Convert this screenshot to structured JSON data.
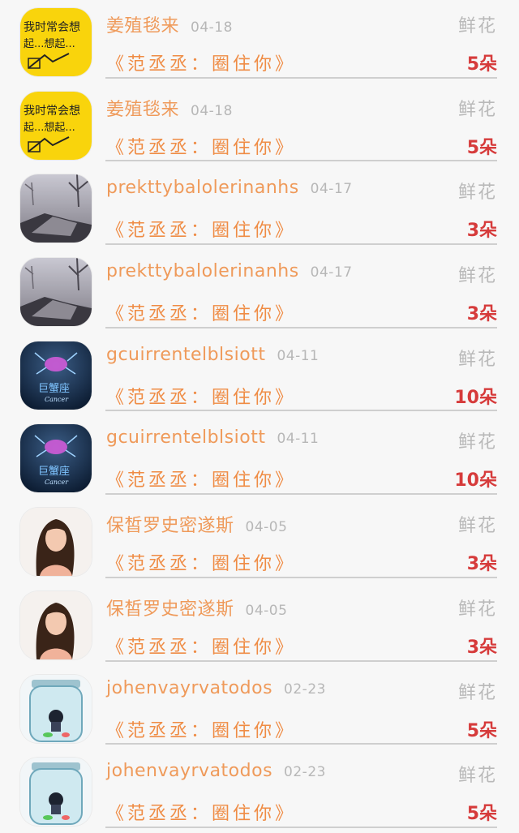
{
  "records": [
    {
      "name": "姜殖毯来",
      "date": "04-18",
      "gift": "鲜花",
      "title": "《范丞丞：圈住你》",
      "count": "5朵",
      "avatar_icon": "handwriting-avatar-icon"
    },
    {
      "name": "姜殖毯来",
      "date": "04-18",
      "gift": "鲜花",
      "title": "《范丞丞：圈住你》",
      "count": "5朵",
      "avatar_icon": "handwriting-avatar-icon"
    },
    {
      "name": "prekttybalolerinanhs",
      "date": "04-17",
      "gift": "鲜花",
      "title": "《范丞丞：圈住你》",
      "count": "3朵",
      "avatar_icon": "misty-forest-avatar-icon"
    },
    {
      "name": "prekttybalolerinanhs",
      "date": "04-17",
      "gift": "鲜花",
      "title": "《范丞丞：圈住你》",
      "count": "3朵",
      "avatar_icon": "misty-forest-avatar-icon"
    },
    {
      "name": "gcuirrentelblsiott",
      "date": "04-11",
      "gift": "鲜花",
      "title": "《范丞丞：圈住你》",
      "count": "10朵",
      "avatar_icon": "cancer-zodiac-avatar-icon"
    },
    {
      "name": "gcuirrentelblsiott",
      "date": "04-11",
      "gift": "鲜花",
      "title": "《范丞丞：圈住你》",
      "count": "10朵",
      "avatar_icon": "cancer-zodiac-avatar-icon"
    },
    {
      "name": "保皙罗史密遂斯",
      "date": "04-05",
      "gift": "鲜花",
      "title": "《范丞丞：圈住你》",
      "count": "3朵",
      "avatar_icon": "woman-portrait-avatar-icon"
    },
    {
      "name": "保皙罗史密遂斯",
      "date": "04-05",
      "gift": "鲜花",
      "title": "《范丞丞：圈住你》",
      "count": "3朵",
      "avatar_icon": "woman-portrait-avatar-icon"
    },
    {
      "name": "johenvayrvatodos",
      "date": "02-23",
      "gift": "鲜花",
      "title": "《范丞丞：圈住你》",
      "count": "5朵",
      "avatar_icon": "jar-figure-avatar-icon"
    },
    {
      "name": "johenvayrvatodos",
      "date": "02-23",
      "gift": "鲜花",
      "title": "《范丞丞：圈住你》",
      "count": "5朵",
      "avatar_icon": "jar-figure-avatar-icon"
    }
  ],
  "avatar_text": {
    "handwriting_line1": "我时常会想",
    "handwriting_line2": "起...想起...",
    "zodiac_label": "巨蟹座",
    "zodiac_sub": "Cancer"
  },
  "colors": {
    "name": "#ef9a5a",
    "title": "#ef8c45",
    "count": "#d63b3b",
    "gift": "#b9b9b9",
    "date": "#b7b7b7"
  }
}
